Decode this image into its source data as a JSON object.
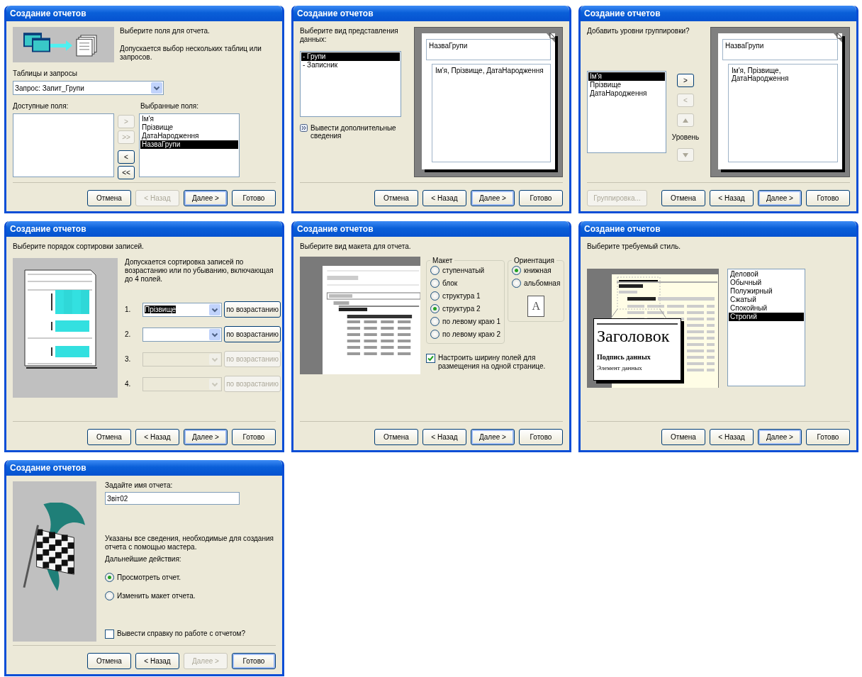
{
  "dialogs": [
    {
      "kind": "fields",
      "title": "Создание отчетов",
      "intro": "Выберите поля для отчета.",
      "note": "Допускается выбор нескольких таблиц или запросов.",
      "source_label": "Таблицы и запросы",
      "source_value": "Запрос: Запит_Групи",
      "available_label": "Доступные поля:",
      "chosen_label": "Выбранные поля:",
      "chosen": [
        {
          "label": "Ім'я",
          "selected": false
        },
        {
          "label": "Прізвище",
          "selected": false
        },
        {
          "label": "ДатаНародження",
          "selected": false
        },
        {
          "label": "НазваГрупи",
          "selected": true
        }
      ],
      "moves": [
        {
          "label": ">",
          "disabled": true
        },
        {
          "label": ">>",
          "disabled": true
        },
        {
          "label": "<",
          "disabled": false
        },
        {
          "label": "<<",
          "disabled": false
        }
      ],
      "buttons": [
        {
          "label": "Отмена",
          "disabled": false,
          "default": false
        },
        {
          "label": "< Назад",
          "disabled": true,
          "default": false
        },
        {
          "label": "Далее >",
          "disabled": false,
          "default": true
        },
        {
          "label": "Готово",
          "disabled": false,
          "default": false
        }
      ]
    },
    {
      "kind": "view",
      "title": "Создание отчетов",
      "prompt": "Выберите вид представления данных:",
      "views": [
        {
          "label": "- Групи",
          "selected": true
        },
        {
          "label": "- Записник",
          "selected": false
        }
      ],
      "more": "Вывести дополнительные сведения",
      "preview": {
        "header": "НазваГрупи",
        "detail": "Ім'я, Прізвище, ДатаНародження"
      },
      "buttons": [
        {
          "label": "Отмена",
          "disabled": false,
          "default": false
        },
        {
          "label": "< Назад",
          "disabled": false,
          "default": false
        },
        {
          "label": "Далее >",
          "disabled": false,
          "default": true
        },
        {
          "label": "Готово",
          "disabled": false,
          "default": false
        }
      ]
    },
    {
      "kind": "grouping",
      "title": "Создание отчетов",
      "prompt": "Добавить уровни группировки?",
      "fields": [
        {
          "label": "Ім'я",
          "selected": true
        },
        {
          "label": "Прізвище",
          "selected": false
        },
        {
          "label": "ДатаНародження",
          "selected": false
        }
      ],
      "moves": [
        {
          "kind": "text",
          "label": ">",
          "disabled": false
        },
        {
          "kind": "text",
          "label": "<",
          "disabled": true
        },
        {
          "kind": "up",
          "disabled": true
        },
        {
          "kind": "level",
          "label": "Уровень"
        },
        {
          "kind": "down",
          "disabled": true
        }
      ],
      "preview": {
        "header": "НазваГрупи",
        "detail": "Ім'я, Прізвище, ДатаНародження"
      },
      "extra_button": {
        "label": "Группировка...",
        "disabled": true
      },
      "buttons": [
        {
          "label": "Отмена",
          "disabled": false,
          "default": false
        },
        {
          "label": "< Назад",
          "disabled": false,
          "default": false
        },
        {
          "label": "Далее >",
          "disabled": false,
          "default": true
        },
        {
          "label": "Готово",
          "disabled": false,
          "default": false
        }
      ]
    },
    {
      "kind": "sort",
      "title": "Создание отчетов",
      "prompt": "Выберите порядок сортировки записей.",
      "note": "Допускается сортировка записей по возрастанию или по убыванию, включающая до 4 полей.",
      "rows": [
        {
          "number": "1.",
          "field": "Прізвище",
          "highlighted": true,
          "order": "по возрастанию",
          "disabled": false
        },
        {
          "number": "2.",
          "order": "по возрастанию",
          "disabled": false
        },
        {
          "number": "3.",
          "order": "по возрастанию",
          "disabled": true
        },
        {
          "number": "4.",
          "order": "по возрастанию",
          "disabled": true
        }
      ],
      "buttons": [
        {
          "label": "Отмена",
          "disabled": false,
          "default": false
        },
        {
          "label": "< Назад",
          "disabled": false,
          "default": false
        },
        {
          "label": "Далее >",
          "disabled": false,
          "default": true
        },
        {
          "label": "Готово",
          "disabled": false,
          "default": false
        }
      ]
    },
    {
      "kind": "layout",
      "title": "Создание отчетов",
      "prompt": "Выберите вид макета для отчета.",
      "layout_group": {
        "label": "Макет",
        "options": [
          {
            "label": "ступенчатый",
            "selected": false
          },
          {
            "label": "блок",
            "selected": false
          },
          {
            "label": "структура 1",
            "selected": false
          },
          {
            "label": "структура 2",
            "selected": true
          },
          {
            "label": "по левому краю 1",
            "selected": false
          },
          {
            "label": "по левому краю 2",
            "selected": false
          }
        ]
      },
      "orientation_group": {
        "label": "Ориентация",
        "options": [
          {
            "label": "книжная",
            "selected": true
          },
          {
            "label": "альбомная",
            "selected": false
          }
        ],
        "page_letter": "A"
      },
      "fit": {
        "label": "Настроить ширину полей для размещения на одной странице.",
        "checked": true
      },
      "buttons": [
        {
          "label": "Отмена",
          "disabled": false,
          "default": false
        },
        {
          "label": "< Назад",
          "disabled": false,
          "default": false
        },
        {
          "label": "Далее >",
          "disabled": false,
          "default": true
        },
        {
          "label": "Готово",
          "disabled": false,
          "default": false
        }
      ]
    },
    {
      "kind": "style",
      "title": "Создание отчетов",
      "prompt": "Выберите требуемый стиль.",
      "sample": {
        "heading": "Заголовок",
        "caption": "Подпись данных",
        "element": "Элемент данных"
      },
      "styles": [
        {
          "label": "Деловой",
          "selected": false
        },
        {
          "label": "Обычный",
          "selected": false
        },
        {
          "label": "Полужирный",
          "selected": false
        },
        {
          "label": "Сжатый",
          "selected": false
        },
        {
          "label": "Спокойный",
          "selected": false
        },
        {
          "label": "Строгий",
          "selected": true
        }
      ],
      "buttons": [
        {
          "label": "Отмена",
          "disabled": false,
          "default": false
        },
        {
          "label": "< Назад",
          "disabled": false,
          "default": false
        },
        {
          "label": "Далее >",
          "disabled": false,
          "default": true
        },
        {
          "label": "Готово",
          "disabled": false,
          "default": false
        }
      ]
    },
    {
      "kind": "finish",
      "title": "Создание отчетов",
      "prompt": "Задайте имя отчета:",
      "name_value": "Звіт02",
      "info": "Указаны все сведения, необходимые для создания отчета с помощью мастера.",
      "next_label": "Дальнейшие действия:",
      "actions": [
        {
          "label": "Просмотреть отчет.",
          "selected": true
        },
        {
          "label": "Изменить макет отчета.",
          "selected": false
        }
      ],
      "help": {
        "label": "Вывести справку по работе с отчетом?",
        "checked": false
      },
      "buttons": [
        {
          "label": "Отмена",
          "disabled": false,
          "default": false
        },
        {
          "label": "< Назад",
          "disabled": false,
          "default": false
        },
        {
          "label": "Далее >",
          "disabled": true,
          "default": false
        },
        {
          "label": "Готово",
          "disabled": false,
          "default": true
        }
      ]
    }
  ]
}
